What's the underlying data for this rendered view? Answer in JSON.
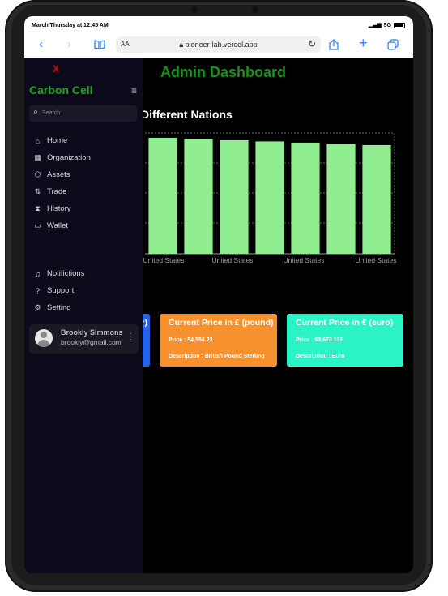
{
  "status_bar": {
    "time": "March Thursday at 12:45 AM",
    "signal": "5G"
  },
  "browser": {
    "url": "pioneer-lab.vercel.app",
    "text_size": "AA"
  },
  "sidebar": {
    "close_label": "X",
    "brand": "Carbon Cell",
    "search_placeholder": "Search",
    "nav": [
      {
        "label": "Home",
        "icon": "home-icon"
      },
      {
        "label": "Organization",
        "icon": "building-icon"
      },
      {
        "label": "Assets",
        "icon": "cube-icon"
      },
      {
        "label": "Trade",
        "icon": "swap-icon"
      },
      {
        "label": "History",
        "icon": "hourglass-icon"
      },
      {
        "label": "Wallet",
        "icon": "wallet-icon"
      }
    ],
    "secondary": [
      {
        "label": "Notifictions",
        "icon": "bell-icon"
      },
      {
        "label": "Support",
        "icon": "help-icon"
      },
      {
        "label": "Setting",
        "icon": "gear-icon"
      }
    ],
    "profile": {
      "name": "Brookly Simmons",
      "email": "brookly@gmail.com"
    }
  },
  "main": {
    "title": "Admin Dashboard",
    "chart_title": "Different Nations"
  },
  "chart_data": {
    "type": "bar",
    "title": "Different Nations",
    "categories": [
      "",
      "United States",
      "",
      "United States",
      "",
      "United States",
      "",
      "United States"
    ],
    "values": [
      96,
      95,
      94,
      93,
      92,
      91,
      90
    ],
    "bar_color": "#90ee90",
    "grid": true,
    "ylim": [
      0,
      100
    ]
  },
  "cards": [
    {
      "title": "r)",
      "price": "",
      "description": "",
      "color": "#2563eb"
    },
    {
      "title": "Current Price in £ (pound)",
      "price": "Price : 54,554.23",
      "description": "Description : British Pound Sterling",
      "color": "#f7912d"
    },
    {
      "title": "Current Price in € (euro)",
      "price": "Price : 63,673.113",
      "description": "Description : Euro",
      "color": "#2cf3c6"
    }
  ]
}
